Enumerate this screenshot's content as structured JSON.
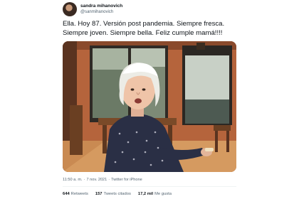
{
  "author": {
    "display_name": "sandra mihanovich",
    "handle": "@sanmihanovich",
    "avatar_icon": "profile-photo-avatar"
  },
  "tweet": {
    "lines": [
      "Ella. Hoy 87. Versión post pandemia. Siempre fresca.",
      "Siempre joven. Siempre bella. Feliz cumple mamá!!!!"
    ]
  },
  "media": {
    "icon": "photo-elderly-woman-smiling"
  },
  "meta": {
    "time": "11:50 a. m.",
    "separator": "·",
    "date": "7 nov. 2021",
    "source": "Twitter for iPhone"
  },
  "stats": {
    "retweets_count": "644",
    "retweets_label": "Retweets",
    "quotes_count": "157",
    "quotes_label": "Tweets citados",
    "likes_count": "17,2 mil",
    "likes_label": "Me gusta"
  }
}
